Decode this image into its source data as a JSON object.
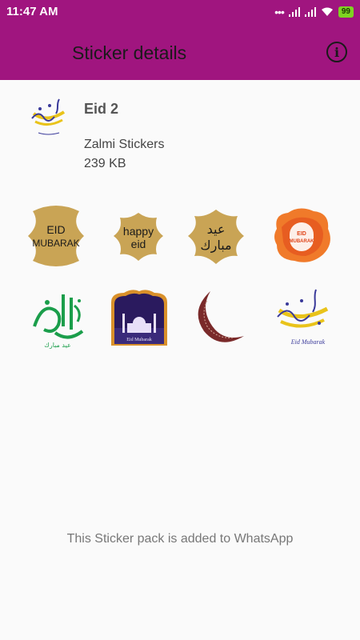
{
  "status_bar": {
    "time": "11:47 AM",
    "battery": "99",
    "icons": [
      "dots-icon",
      "signal-icon",
      "signal-icon",
      "wifi-icon",
      "battery-icon"
    ]
  },
  "app_bar": {
    "title": "Sticker details",
    "info_icon": "info-icon"
  },
  "pack": {
    "name": "Eid 2",
    "publisher": "Zalmi Stickers",
    "size": "239 KB"
  },
  "stickers": [
    {
      "name": "eid-mubarak-frame",
      "text_1": "EID",
      "text_2": "MUBARAK"
    },
    {
      "name": "happy-eid-frame",
      "text_1": "happy",
      "text_2": "eid"
    },
    {
      "name": "arabic-eid-frame",
      "text_1": "عيد",
      "text_2": "مبارك"
    },
    {
      "name": "watercolor-eid-badge",
      "text_1": "EID",
      "text_2": "MUBARAK"
    },
    {
      "name": "green-calligraphy",
      "text_1": "عيد مبارك"
    },
    {
      "name": "mosque-card",
      "text_1": "Eid Mubarak"
    },
    {
      "name": "crescent-moon"
    },
    {
      "name": "blue-yellow-calligraphy",
      "text_1": "Eid Mubarak"
    }
  ],
  "footer": "This Sticker pack is added to WhatsApp",
  "colors": {
    "brand": "#a0157f",
    "gold": "#c9a455",
    "green": "#1b9e4b"
  }
}
